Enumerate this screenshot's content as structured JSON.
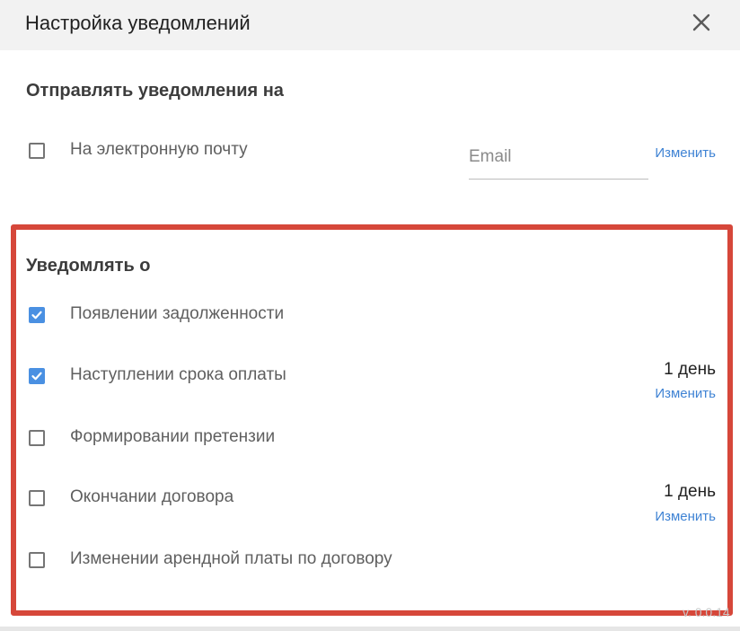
{
  "dialog": {
    "title": "Настройка уведомлений",
    "close_icon": "close-icon"
  },
  "send_section": {
    "title": "Отправлять уведомления на",
    "email_option": {
      "label": "На электронную почту",
      "checked": false,
      "email_placeholder": "Email",
      "change_label": "Изменить"
    }
  },
  "notify_section": {
    "title": "Уведомлять о",
    "items": [
      {
        "label": "Появлении задолженности",
        "checked": true
      },
      {
        "label": "Наступлении срока оплаты",
        "checked": true,
        "period": "1 день",
        "change_label": "Изменить"
      },
      {
        "label": "Формировании претензии",
        "checked": false
      },
      {
        "label": "Окончании договора",
        "checked": false,
        "period": "1 день",
        "change_label": "Изменить"
      },
      {
        "label": "Изменении арендной платы по договору",
        "checked": false
      }
    ]
  },
  "version": "v. 0.0.14",
  "colors": {
    "accent": "#4a90e2",
    "link": "#3f83d4",
    "highlight": "#d6473a",
    "header_bg": "#f2f2f2"
  }
}
